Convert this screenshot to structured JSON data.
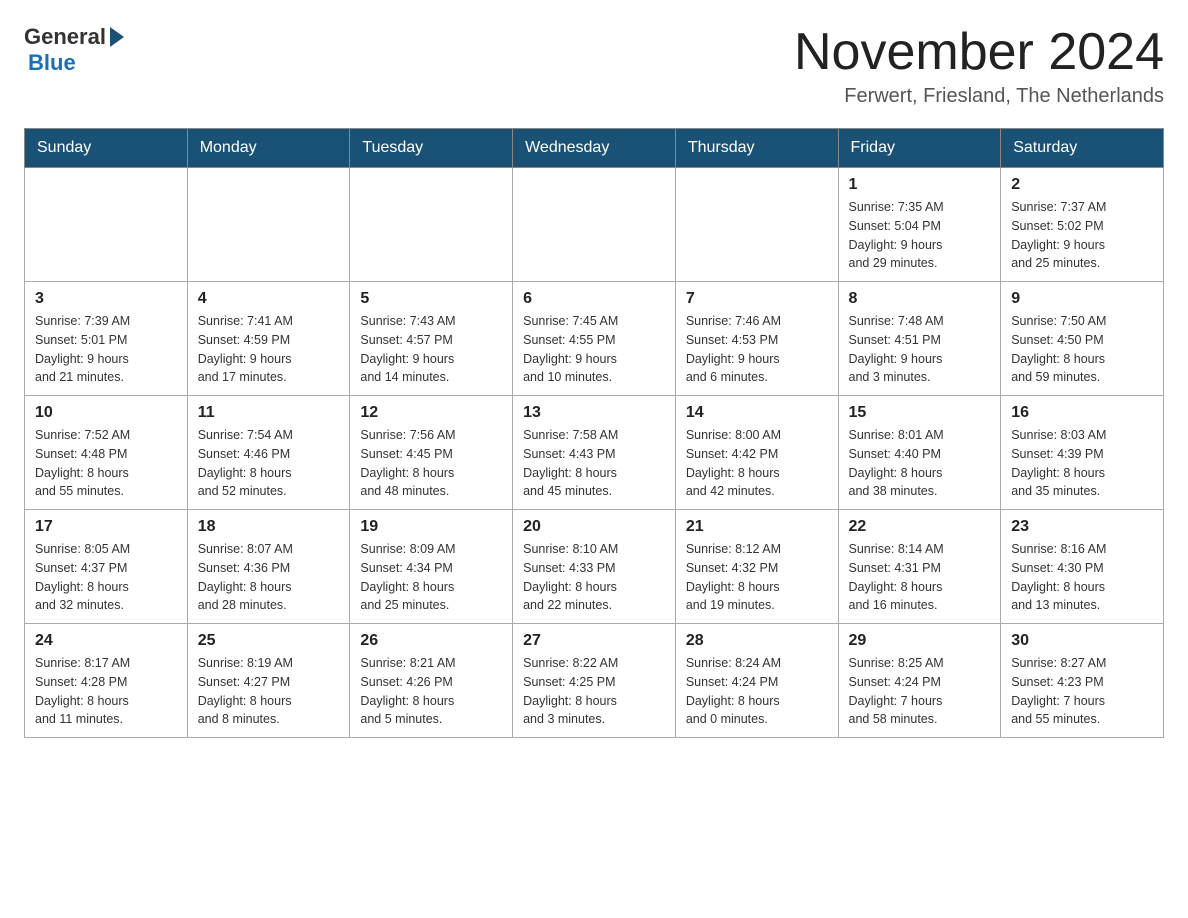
{
  "header": {
    "logo_general": "General",
    "logo_blue": "Blue",
    "month_title": "November 2024",
    "location": "Ferwert, Friesland, The Netherlands"
  },
  "days_of_week": [
    "Sunday",
    "Monday",
    "Tuesday",
    "Wednesday",
    "Thursday",
    "Friday",
    "Saturday"
  ],
  "weeks": [
    [
      {
        "day": "",
        "info": ""
      },
      {
        "day": "",
        "info": ""
      },
      {
        "day": "",
        "info": ""
      },
      {
        "day": "",
        "info": ""
      },
      {
        "day": "",
        "info": ""
      },
      {
        "day": "1",
        "info": "Sunrise: 7:35 AM\nSunset: 5:04 PM\nDaylight: 9 hours\nand 29 minutes."
      },
      {
        "day": "2",
        "info": "Sunrise: 7:37 AM\nSunset: 5:02 PM\nDaylight: 9 hours\nand 25 minutes."
      }
    ],
    [
      {
        "day": "3",
        "info": "Sunrise: 7:39 AM\nSunset: 5:01 PM\nDaylight: 9 hours\nand 21 minutes."
      },
      {
        "day": "4",
        "info": "Sunrise: 7:41 AM\nSunset: 4:59 PM\nDaylight: 9 hours\nand 17 minutes."
      },
      {
        "day": "5",
        "info": "Sunrise: 7:43 AM\nSunset: 4:57 PM\nDaylight: 9 hours\nand 14 minutes."
      },
      {
        "day": "6",
        "info": "Sunrise: 7:45 AM\nSunset: 4:55 PM\nDaylight: 9 hours\nand 10 minutes."
      },
      {
        "day": "7",
        "info": "Sunrise: 7:46 AM\nSunset: 4:53 PM\nDaylight: 9 hours\nand 6 minutes."
      },
      {
        "day": "8",
        "info": "Sunrise: 7:48 AM\nSunset: 4:51 PM\nDaylight: 9 hours\nand 3 minutes."
      },
      {
        "day": "9",
        "info": "Sunrise: 7:50 AM\nSunset: 4:50 PM\nDaylight: 8 hours\nand 59 minutes."
      }
    ],
    [
      {
        "day": "10",
        "info": "Sunrise: 7:52 AM\nSunset: 4:48 PM\nDaylight: 8 hours\nand 55 minutes."
      },
      {
        "day": "11",
        "info": "Sunrise: 7:54 AM\nSunset: 4:46 PM\nDaylight: 8 hours\nand 52 minutes."
      },
      {
        "day": "12",
        "info": "Sunrise: 7:56 AM\nSunset: 4:45 PM\nDaylight: 8 hours\nand 48 minutes."
      },
      {
        "day": "13",
        "info": "Sunrise: 7:58 AM\nSunset: 4:43 PM\nDaylight: 8 hours\nand 45 minutes."
      },
      {
        "day": "14",
        "info": "Sunrise: 8:00 AM\nSunset: 4:42 PM\nDaylight: 8 hours\nand 42 minutes."
      },
      {
        "day": "15",
        "info": "Sunrise: 8:01 AM\nSunset: 4:40 PM\nDaylight: 8 hours\nand 38 minutes."
      },
      {
        "day": "16",
        "info": "Sunrise: 8:03 AM\nSunset: 4:39 PM\nDaylight: 8 hours\nand 35 minutes."
      }
    ],
    [
      {
        "day": "17",
        "info": "Sunrise: 8:05 AM\nSunset: 4:37 PM\nDaylight: 8 hours\nand 32 minutes."
      },
      {
        "day": "18",
        "info": "Sunrise: 8:07 AM\nSunset: 4:36 PM\nDaylight: 8 hours\nand 28 minutes."
      },
      {
        "day": "19",
        "info": "Sunrise: 8:09 AM\nSunset: 4:34 PM\nDaylight: 8 hours\nand 25 minutes."
      },
      {
        "day": "20",
        "info": "Sunrise: 8:10 AM\nSunset: 4:33 PM\nDaylight: 8 hours\nand 22 minutes."
      },
      {
        "day": "21",
        "info": "Sunrise: 8:12 AM\nSunset: 4:32 PM\nDaylight: 8 hours\nand 19 minutes."
      },
      {
        "day": "22",
        "info": "Sunrise: 8:14 AM\nSunset: 4:31 PM\nDaylight: 8 hours\nand 16 minutes."
      },
      {
        "day": "23",
        "info": "Sunrise: 8:16 AM\nSunset: 4:30 PM\nDaylight: 8 hours\nand 13 minutes."
      }
    ],
    [
      {
        "day": "24",
        "info": "Sunrise: 8:17 AM\nSunset: 4:28 PM\nDaylight: 8 hours\nand 11 minutes."
      },
      {
        "day": "25",
        "info": "Sunrise: 8:19 AM\nSunset: 4:27 PM\nDaylight: 8 hours\nand 8 minutes."
      },
      {
        "day": "26",
        "info": "Sunrise: 8:21 AM\nSunset: 4:26 PM\nDaylight: 8 hours\nand 5 minutes."
      },
      {
        "day": "27",
        "info": "Sunrise: 8:22 AM\nSunset: 4:25 PM\nDaylight: 8 hours\nand 3 minutes."
      },
      {
        "day": "28",
        "info": "Sunrise: 8:24 AM\nSunset: 4:24 PM\nDaylight: 8 hours\nand 0 minutes."
      },
      {
        "day": "29",
        "info": "Sunrise: 8:25 AM\nSunset: 4:24 PM\nDaylight: 7 hours\nand 58 minutes."
      },
      {
        "day": "30",
        "info": "Sunrise: 8:27 AM\nSunset: 4:23 PM\nDaylight: 7 hours\nand 55 minutes."
      }
    ]
  ]
}
